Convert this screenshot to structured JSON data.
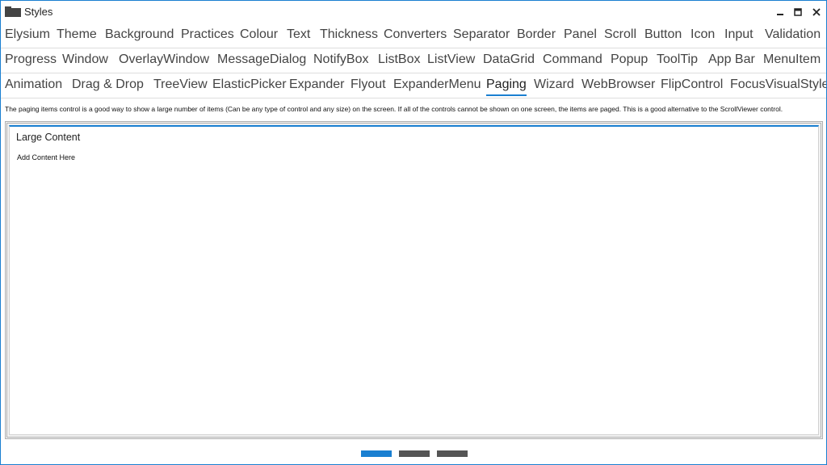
{
  "window": {
    "title": "Styles",
    "icon": "folder-icon",
    "controls": [
      "minimize-icon",
      "maximize-icon",
      "close-icon"
    ]
  },
  "tab_rows": [
    [
      "Elysium",
      "Theme",
      "Background",
      "Practices",
      "Colour",
      "Text",
      "Thickness",
      "Converters",
      "Separator",
      "Border",
      "Panel",
      "Scroll",
      "Button",
      "Icon",
      "Input",
      "Validation"
    ],
    [
      "Progress",
      "Window",
      "OverlayWindow",
      "MessageDialog",
      "NotifyBox",
      "ListBox",
      "ListView",
      "DataGrid",
      "Command",
      "Popup",
      "ToolTip",
      "App Bar",
      "MenuItem"
    ],
    [
      "Animation",
      "Drag & Drop",
      "TreeView",
      "ElasticPicker",
      "Expander",
      "Flyout",
      "ExpanderMenu",
      "Paging",
      "Wizard",
      "WebBrowser",
      "FlipControl",
      "FocusVisualStyle"
    ]
  ],
  "active_tab": "Paging",
  "description": "The paging items control is a good way to show a large number of items (Can be any type of control and any size) on the screen. If all of the controls cannot be shown on one screen, the items are paged. This is a good alternative to the ScrollViewer control.",
  "content": {
    "title": "Large Content",
    "body": "Add Content Here"
  },
  "pager": {
    "pages": 3,
    "current": 1
  },
  "colors": {
    "accent": "#1a7fd1",
    "pager_inactive": "#555555"
  }
}
